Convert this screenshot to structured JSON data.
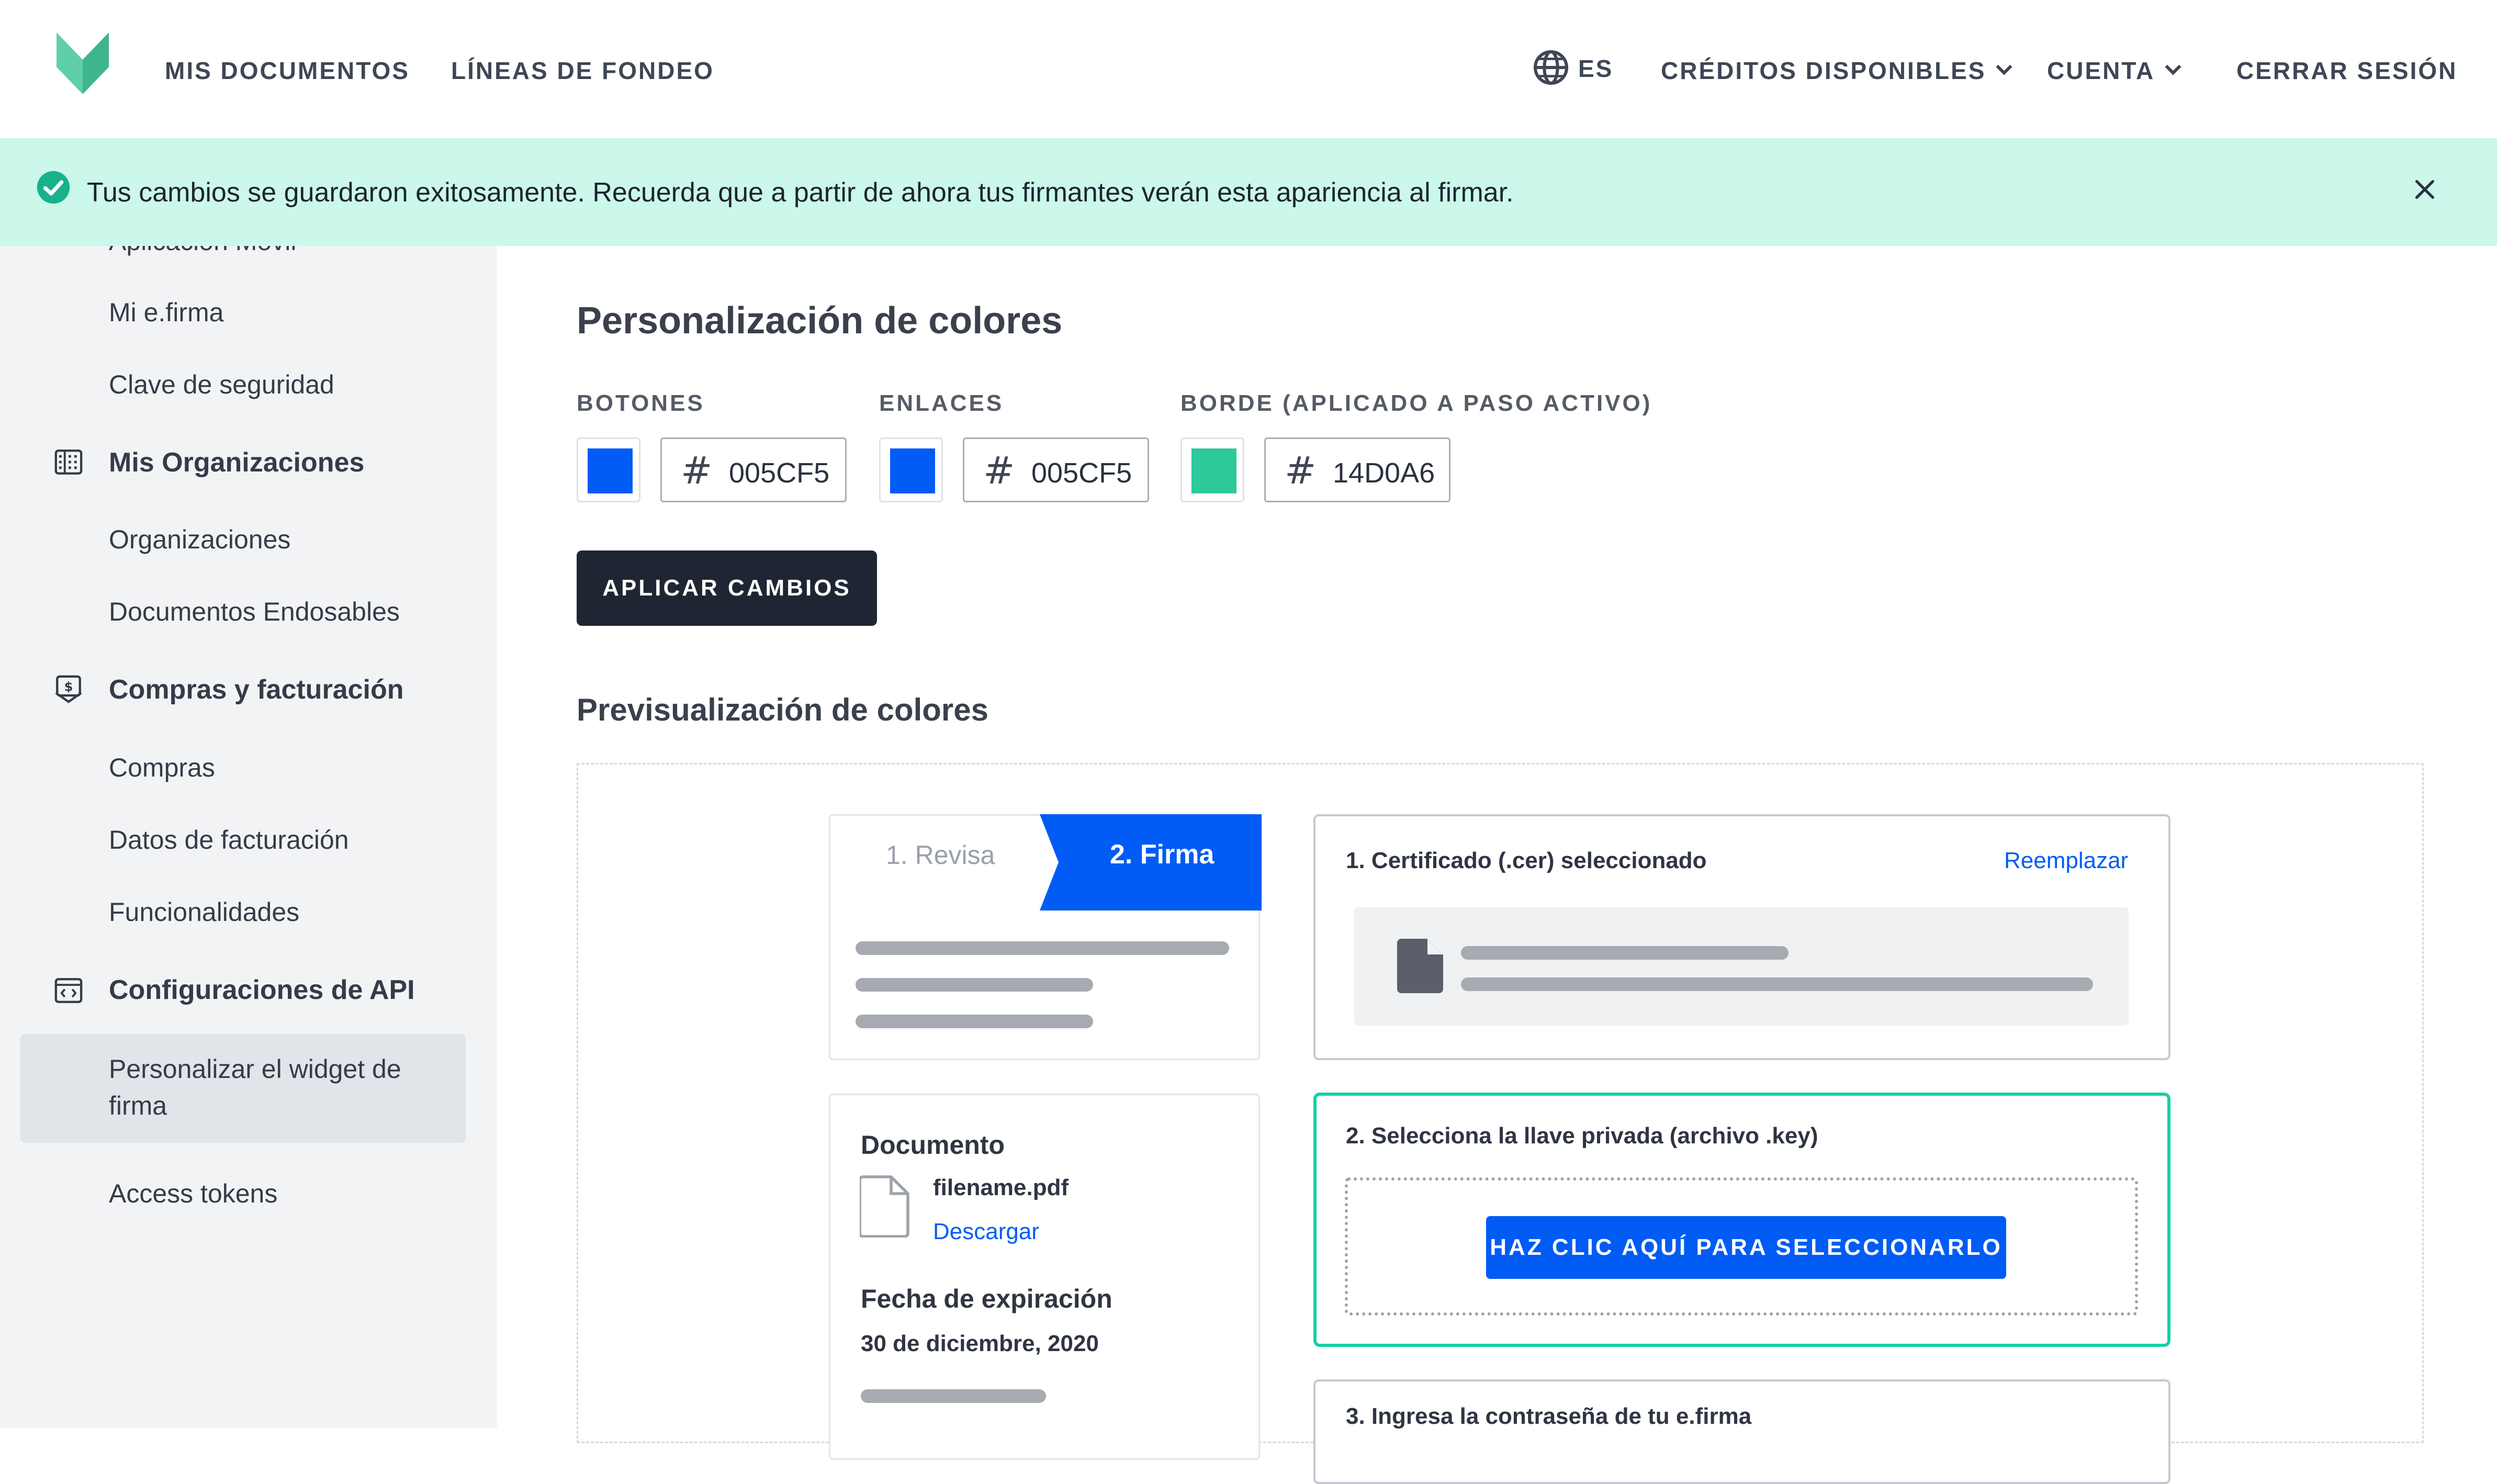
{
  "nav": {
    "links": [
      "MIS DOCUMENTOS",
      "LÍNEAS DE FONDEO"
    ],
    "language": "ES",
    "credits": "CRÉDITOS DISPONIBLES",
    "account": "CUENTA",
    "logout": "CERRAR SESIÓN"
  },
  "banner": {
    "message": "Tus cambios se guardaron exitosamente. Recuerda que a partir de ahora tus firmantes verán esta apariencia al firmar."
  },
  "sidebar": {
    "partial_item": "Aplicación Móvil",
    "item_efirma": "Mi e.firma",
    "item_clave": "Clave de seguridad",
    "section_orgs": "Mis Organizaciones",
    "item_orgs": "Organizaciones",
    "item_endosables": "Documentos Endosables",
    "section_compras": "Compras y facturación",
    "item_compras": "Compras",
    "item_facturacion": "Datos de facturación",
    "item_funcionalidades": "Funcionalidades",
    "section_api": "Configuraciones de API",
    "item_widget_line1": "Personalizar el widget de",
    "item_widget_line2": "firma",
    "item_tokens": "Access tokens"
  },
  "main": {
    "title": "Personalización de colores",
    "colors": [
      {
        "label": "BOTONES",
        "hex": "005CF5",
        "color": "#005CF5"
      },
      {
        "label": "ENLACES",
        "hex": "005CF5",
        "color": "#005CF5"
      },
      {
        "label": "BORDE (APLICADO A PASO ACTIVO)",
        "hex": "14D0A6",
        "color": "#14D0A6"
      }
    ],
    "apply_button": "APLICAR CAMBIOS",
    "preview_title": "Previsualización de colores"
  },
  "preview": {
    "step1": "1. Revisa",
    "step2": "2. Firma",
    "cert_title": "1. Certificado (.cer) seleccionado",
    "replace_link": "Reemplazar",
    "doc_label": "Documento",
    "filename": "filename.pdf",
    "download": "Descargar",
    "expiry_label": "Fecha de expiración",
    "expiry_date": "30 de diciembre, 2020",
    "key_title": "2. Selecciona la llave privada (archivo .key)",
    "select_button": "HAZ CLIC AQUÍ PARA SELECCIONARLO",
    "password_title": "3. Ingresa la contraseña de tu e.firma"
  },
  "theme": {
    "accent": "#005CF5",
    "border_active": "#14D0A6",
    "success_bg": "#CBF8EA",
    "success_icon": "#17B28B",
    "dark_button": "#1F2633"
  }
}
